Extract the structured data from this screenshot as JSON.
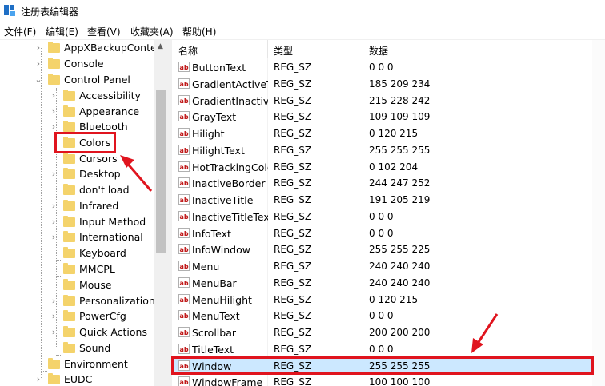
{
  "window": {
    "title": "注册表编辑器",
    "icon": "registry-editor-icon"
  },
  "menu": [
    {
      "label": "文件(F)"
    },
    {
      "label": "编辑(E)"
    },
    {
      "label": "查看(V)"
    },
    {
      "label": "收藏夹(A)"
    },
    {
      "label": "帮助(H)"
    }
  ],
  "tree": {
    "nodes": [
      {
        "label": "AppXBackupConter",
        "expander": "›"
      },
      {
        "label": "Console",
        "expander": "›"
      },
      {
        "label": "Control Panel",
        "expander": "⌄"
      },
      {
        "label": "Accessibility",
        "expander": "›"
      },
      {
        "label": "Appearance",
        "expander": "›"
      },
      {
        "label": "Bluetooth",
        "expander": "›"
      },
      {
        "label": "Colors",
        "expander": ""
      },
      {
        "label": "Cursors",
        "expander": ""
      },
      {
        "label": "Desktop",
        "expander": "›"
      },
      {
        "label": "don't load",
        "expander": ""
      },
      {
        "label": "Infrared",
        "expander": "›"
      },
      {
        "label": "Input Method",
        "expander": "›"
      },
      {
        "label": "International",
        "expander": "›"
      },
      {
        "label": "Keyboard",
        "expander": ""
      },
      {
        "label": "MMCPL",
        "expander": ""
      },
      {
        "label": "Mouse",
        "expander": ""
      },
      {
        "label": "Personalization",
        "expander": "›"
      },
      {
        "label": "PowerCfg",
        "expander": "›"
      },
      {
        "label": "Quick Actions",
        "expander": "›"
      },
      {
        "label": "Sound",
        "expander": ""
      },
      {
        "label": "Environment",
        "expander": ""
      },
      {
        "label": "EUDC",
        "expander": "›"
      }
    ]
  },
  "columns": {
    "name": "名称",
    "type": "类型",
    "data": "数据"
  },
  "values": [
    {
      "name": "ButtonText",
      "type": "REG_SZ",
      "data": "0 0 0"
    },
    {
      "name": "GradientActiveTitle",
      "type": "REG_SZ",
      "data": "185 209 234"
    },
    {
      "name": "GradientInactiveTitle",
      "type": "REG_SZ",
      "data": "215 228 242"
    },
    {
      "name": "GrayText",
      "type": "REG_SZ",
      "data": "109 109 109"
    },
    {
      "name": "Hilight",
      "type": "REG_SZ",
      "data": "0 120 215"
    },
    {
      "name": "HilightText",
      "type": "REG_SZ",
      "data": "255 255 255"
    },
    {
      "name": "HotTrackingColor",
      "type": "REG_SZ",
      "data": "0 102 204"
    },
    {
      "name": "InactiveBorder",
      "type": "REG_SZ",
      "data": "244 247 252"
    },
    {
      "name": "InactiveTitle",
      "type": "REG_SZ",
      "data": "191 205 219"
    },
    {
      "name": "InactiveTitleText",
      "type": "REG_SZ",
      "data": "0 0 0"
    },
    {
      "name": "InfoText",
      "type": "REG_SZ",
      "data": "0 0 0"
    },
    {
      "name": "InfoWindow",
      "type": "REG_SZ",
      "data": "255 255 225"
    },
    {
      "name": "Menu",
      "type": "REG_SZ",
      "data": "240 240 240"
    },
    {
      "name": "MenuBar",
      "type": "REG_SZ",
      "data": "240 240 240"
    },
    {
      "name": "MenuHilight",
      "type": "REG_SZ",
      "data": "0 120 215"
    },
    {
      "name": "MenuText",
      "type": "REG_SZ",
      "data": "0 0 0"
    },
    {
      "name": "Scrollbar",
      "type": "REG_SZ",
      "data": "200 200 200"
    },
    {
      "name": "TitleText",
      "type": "REG_SZ",
      "data": "0 0 0"
    },
    {
      "name": "Window",
      "type": "REG_SZ",
      "data": "255 255 255"
    },
    {
      "name": "WindowFrame",
      "type": "REG_SZ",
      "data": "100 100 100"
    }
  ],
  "value_icon": {
    "name": "string-value-icon",
    "glyph": "ab"
  },
  "colors": {
    "annotation": "#e0141e",
    "selection": "#cce8ff",
    "folder": "#f4d36b"
  }
}
